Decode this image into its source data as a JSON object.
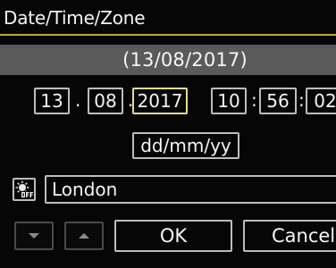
{
  "header": {
    "title": "Date/Time/Zone"
  },
  "summary": {
    "date_display": "(13/08/2017)"
  },
  "datetime": {
    "day": "13",
    "month": "08",
    "year": "2017",
    "hour": "10",
    "minute": "56",
    "second": "02",
    "date_separator": ".",
    "time_separator": ":",
    "active_field": "year"
  },
  "format": {
    "label": "dd/mm/yy"
  },
  "zone": {
    "dst_icon": "daylight-saving-off-icon",
    "value": "London"
  },
  "footer": {
    "down_icon": "triangle-down-icon",
    "up_icon": "triangle-up-icon",
    "ok_label": "OK",
    "cancel_label": "Cancel"
  },
  "colors": {
    "accent_rule": "#c4a030",
    "active_border": "#e8dc90",
    "bar_background": "#5a5a5a"
  }
}
